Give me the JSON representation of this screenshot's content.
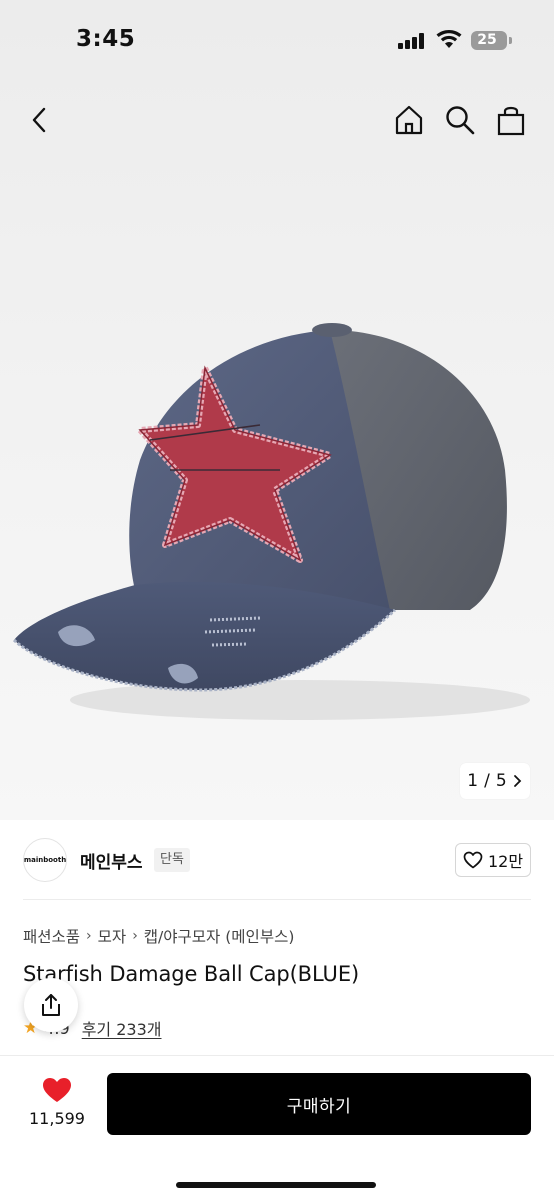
{
  "status_bar": {
    "time": "3:45",
    "battery": "25"
  },
  "nav": {
    "back_icon": "chevron-left-icon",
    "home_icon": "home-icon",
    "search_icon": "search-icon",
    "bag_icon": "shopping-bag-icon"
  },
  "gallery": {
    "current": "1",
    "separator": "/",
    "total": "5"
  },
  "brand": {
    "logo_text": "mainbooth",
    "name": "메인부스",
    "badge": "단독",
    "like_count": "12만"
  },
  "breadcrumb": [
    "패션소품",
    "모자",
    "캡/야구모자 (메인부스)"
  ],
  "product": {
    "title": "Starfish Damage Ball Cap(BLUE)",
    "rating": "4.9",
    "review_label": "후기 233개"
  },
  "bottom_bar": {
    "wish_count": "11,599",
    "buy_label": "구매하기"
  },
  "colors": {
    "accent_heart": "#e8202a",
    "buy_button": "#000000",
    "star": "#f5a623"
  }
}
